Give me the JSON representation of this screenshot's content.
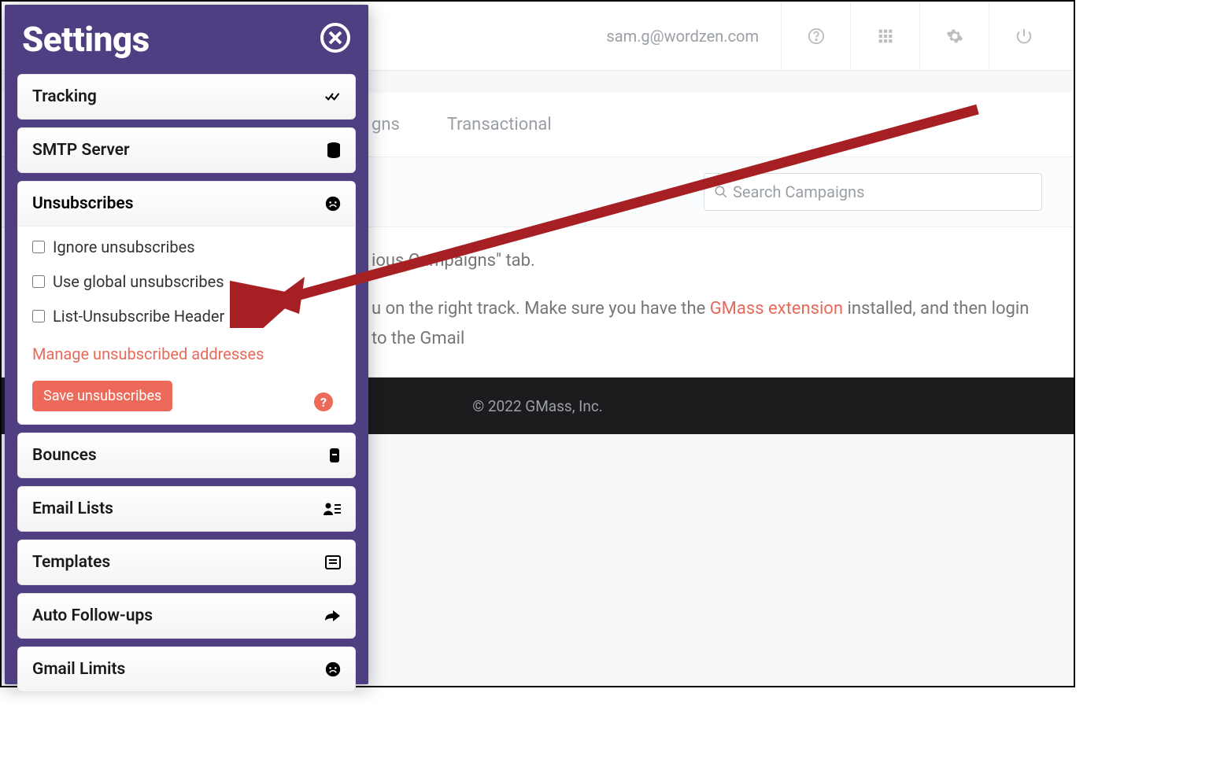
{
  "header": {
    "email": "sam.g@wordzen.com"
  },
  "tabs": {
    "campaigns_fragment": "gns",
    "transactional": "Transactional"
  },
  "search": {
    "placeholder": "Search Campaigns"
  },
  "body": {
    "line1": "ious Campaigns\" tab.",
    "line2_a": "u on the right track. Make sure you have the ",
    "line2_link": "GMass extension",
    "line2_b": " installed, and then login to the Gmail"
  },
  "footer": {
    "text": "© 2022 GMass, Inc."
  },
  "panel": {
    "title": "Settings",
    "sections": {
      "tracking": "Tracking",
      "smtp": "SMTP Server",
      "unsub": "Unsubscribes",
      "bounces": "Bounces",
      "email_lists": "Email Lists",
      "templates": "Templates",
      "auto_follow": "Auto Follow-ups",
      "gmail_limits": "Gmail Limits"
    },
    "unsub_options": {
      "ignore": "Ignore unsubscribes",
      "global": "Use global unsubscribes",
      "header": "List-Unsubscribe Header",
      "manage": "Manage unsubscribed addresses",
      "save": "Save unsubscribes"
    }
  }
}
